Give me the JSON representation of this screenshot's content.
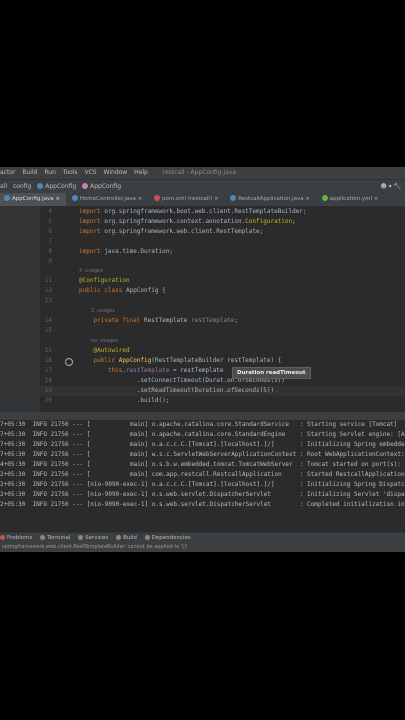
{
  "menubar": {
    "items": [
      "actor",
      "Build",
      "Run",
      "Tools",
      "VCS",
      "Window",
      "Help"
    ],
    "title": "restcall - AppConfig.java"
  },
  "navbar": {
    "crumbs": [
      "all",
      "config",
      "AppConfig",
      "AppConfig"
    ]
  },
  "tabs": [
    {
      "label": "AppConfig.java",
      "color": "#4a88c7"
    },
    {
      "label": "HomeController.java",
      "color": "#4a88c7"
    },
    {
      "label": "pom.xml (restcall)",
      "color": "#c75450"
    },
    {
      "label": "RestcallApplication.java",
      "color": "#4a88c7"
    },
    {
      "label": "application.yml",
      "color": "#62b543"
    }
  ],
  "editor": {
    "lines": [
      {
        "n": "4",
        "text": "import org.springframework.boot.web.client.RestTemplateBuilder;"
      },
      {
        "n": "5",
        "text": "import org.springframework.context.annotation.Configuration;"
      },
      {
        "n": "6",
        "text": "import org.springframework.web.client.RestTemplate;"
      },
      {
        "n": "7",
        "text": ""
      },
      {
        "n": "8",
        "text": "import java.time.Duration;"
      },
      {
        "n": "9",
        "text": ""
      },
      {
        "n": "",
        "text": "3 usages"
      },
      {
        "n": "11",
        "text": "@Configuration"
      },
      {
        "n": "12",
        "text": "public class AppConfig {"
      },
      {
        "n": "13",
        "text": ""
      },
      {
        "n": "",
        "text": "2 usages"
      },
      {
        "n": "14",
        "text": "    private final RestTemplate restTemplate;"
      },
      {
        "n": "15",
        "text": ""
      },
      {
        "n": "",
        "text": "no usages"
      },
      {
        "n": "15",
        "text": "    @Autowired"
      },
      {
        "n": "16",
        "text": "    public AppConfig(RestTemplateBuilder restTemplate) {"
      },
      {
        "n": "17",
        "text": "        this.restTemplate = restTemplate"
      },
      {
        "n": "18",
        "text": "                .setConnectTimeout(Durat.on.ofSeconds(5))"
      },
      {
        "n": "19",
        "text": "                .setReadTimeout(Duration.ofSeconds(5))"
      },
      {
        "n": "20",
        "text": "                .build();"
      }
    ],
    "tooltip": "Duration readTimeout"
  },
  "console": {
    "lines": [
      "7+05:30  INFO 21756 --- [           main] o.apache.catalina.core.StandardService   : Starting service [Tomcat]",
      "7+05:30  INFO 21756 --- [           main] o.apache.catalina.core.StandardEngine    : Starting Servlet engine: [Ap",
      "7+05:30  INFO 21756 --- [           main] o.a.c.c.C.[Tomcat].[localhost].[/]       : Initializing Spring embedded",
      "7+05:30  INFO 21756 --- [           main] w.s.c.ServletWebServerApplicationContext : Root WebApplicationContext: i",
      "4+05:30  INFO 21756 --- [           main] o.s.b.w.embedded.tomcat.TomcatWebServer  : Tomcat started on port(s): 9",
      "2+05:30  INFO 21756 --- [           main] com.app.restcall.RestcallApplication     : Started RestcallApplication i",
      "2+05:30  INFO 21756 --- [nio-9090-exec-1] o.a.c.c.C.[Tomcat].[localhost].[/]       : Initializing Spring Dispatch",
      "2+05:30  INFO 21756 --- [nio-9090-exec-1] o.s.web.servlet.DispatcherServlet        : Initializing Servlet 'dispat",
      "2+05:30  INFO 21756 --- [nio-9090-exec-1] o.s.web.servlet.DispatcherServlet        : Completed initialization in"
    ]
  },
  "bottombar": {
    "items": [
      "Problems",
      "Terminal",
      "Services",
      "Build",
      "Dependencies"
    ]
  },
  "statusbar": {
    "text": "springframework.web.client.RestTemplateBuilder' cannot be applied to '()'"
  }
}
